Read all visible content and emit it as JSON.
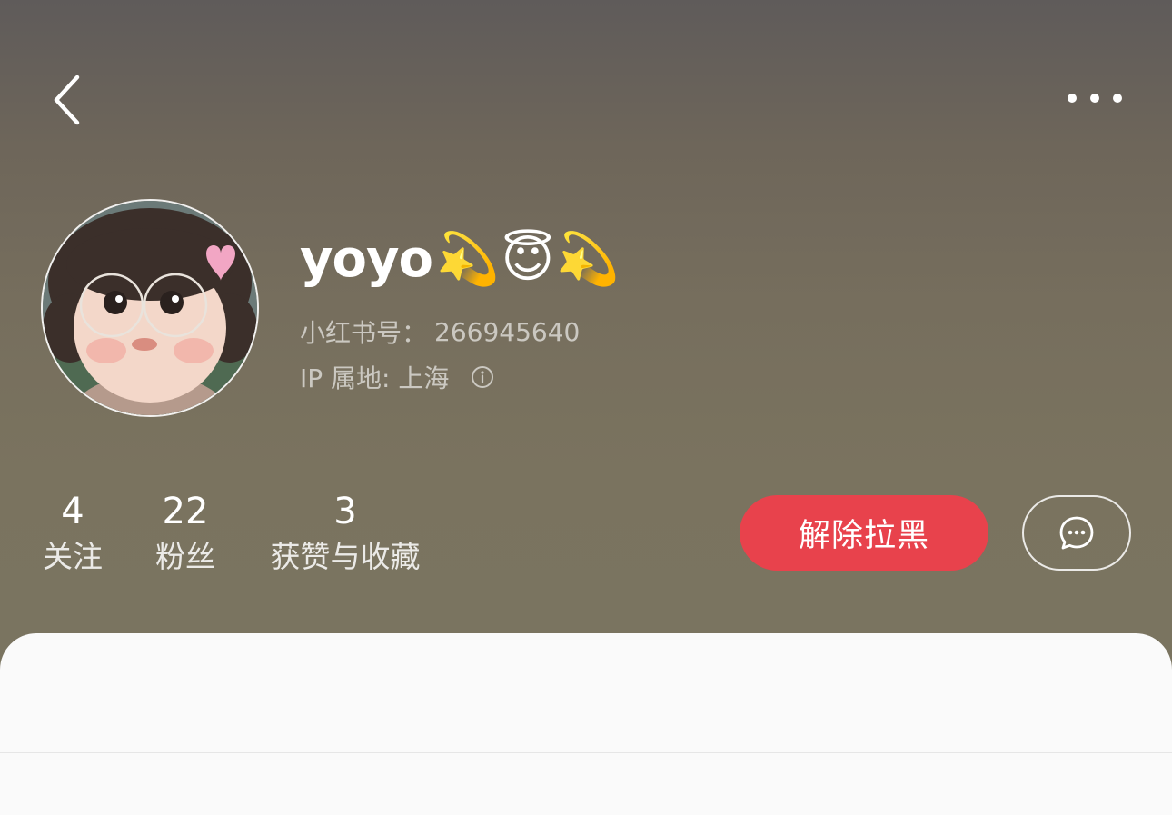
{
  "profile": {
    "username": "yoyo",
    "username_emoji": "💫😇💫",
    "red_id_label": "小红书号：",
    "red_id_value": "266945640",
    "ip_label": "IP 属地: 上海"
  },
  "stats": {
    "following": {
      "value": "4",
      "label": "关注"
    },
    "followers": {
      "value": "22",
      "label": "粉丝"
    },
    "likes_collects": {
      "value": "3",
      "label": "获赞与收藏"
    }
  },
  "actions": {
    "unblock_label": "解除拉黑"
  },
  "icons": {
    "back": "chevron-left-icon",
    "more": "more-dots-icon",
    "info": "info-icon",
    "message": "chat-bubble-icon"
  },
  "colors": {
    "unblock_button": "#e8424c",
    "header_background": "#7a735f"
  }
}
